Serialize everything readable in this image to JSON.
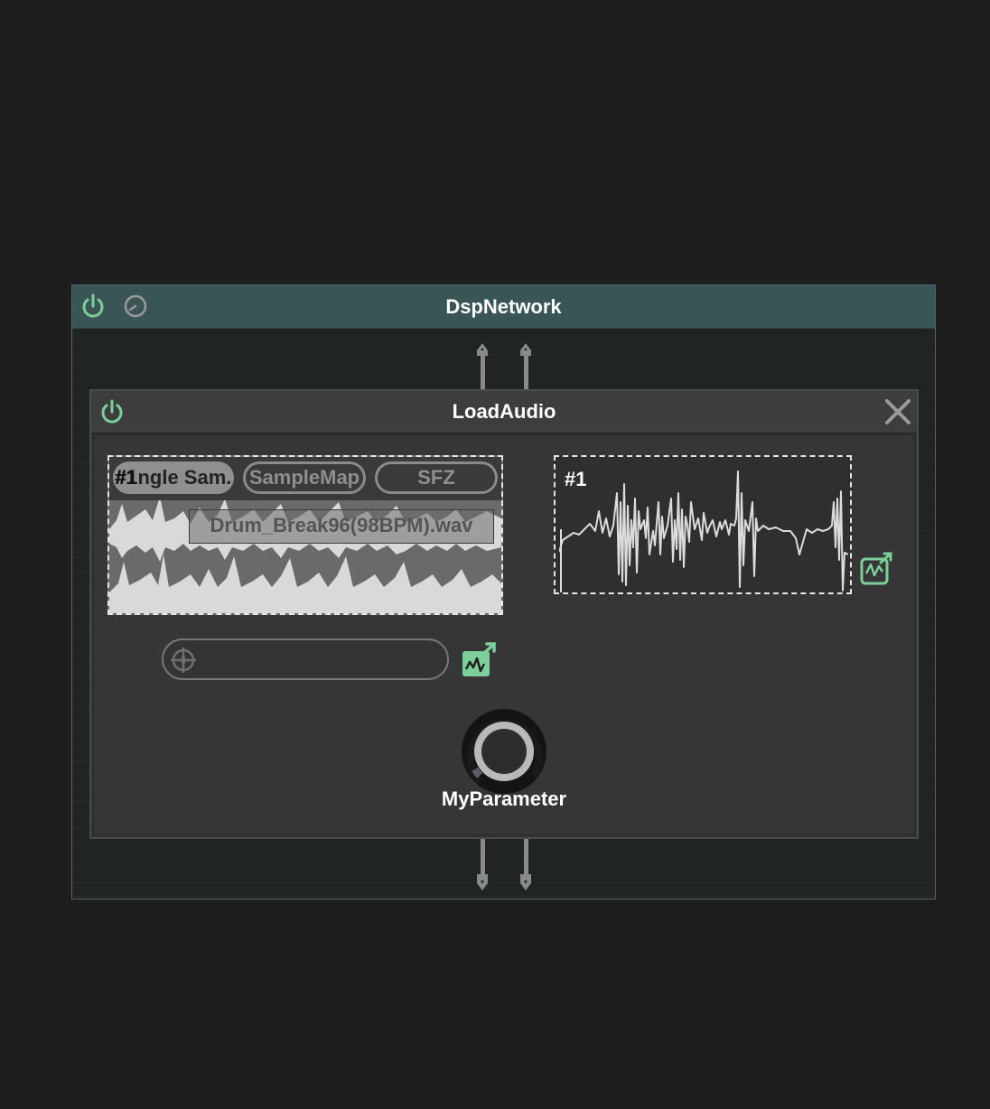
{
  "network": {
    "title": "DspNetwork"
  },
  "node": {
    "title": "LoadAudio"
  },
  "audio_file": {
    "tabs": [
      {
        "label": "#1ngle Sam...",
        "active": true
      },
      {
        "label": "SampleMap",
        "active": false
      },
      {
        "label": "SFZ",
        "active": false
      }
    ],
    "slot_badge": "#1",
    "file_name": "Drum_Break96(98BPM).wav"
  },
  "display": {
    "slot_badge": "#1"
  },
  "search": {
    "placeholder": ""
  },
  "parameter": {
    "label": "MyParameter",
    "value": 0.05
  },
  "colors": {
    "accent": "#7ccf9a",
    "header_teal": "#3a5556",
    "background": "#1d1d1d"
  },
  "icons": {
    "power": "power-icon",
    "cpu": "gauge-icon",
    "close": "close-icon",
    "popout": "external-link-icon",
    "crosshair": "crosshair-icon",
    "drag": "drag-to-export-icon"
  }
}
